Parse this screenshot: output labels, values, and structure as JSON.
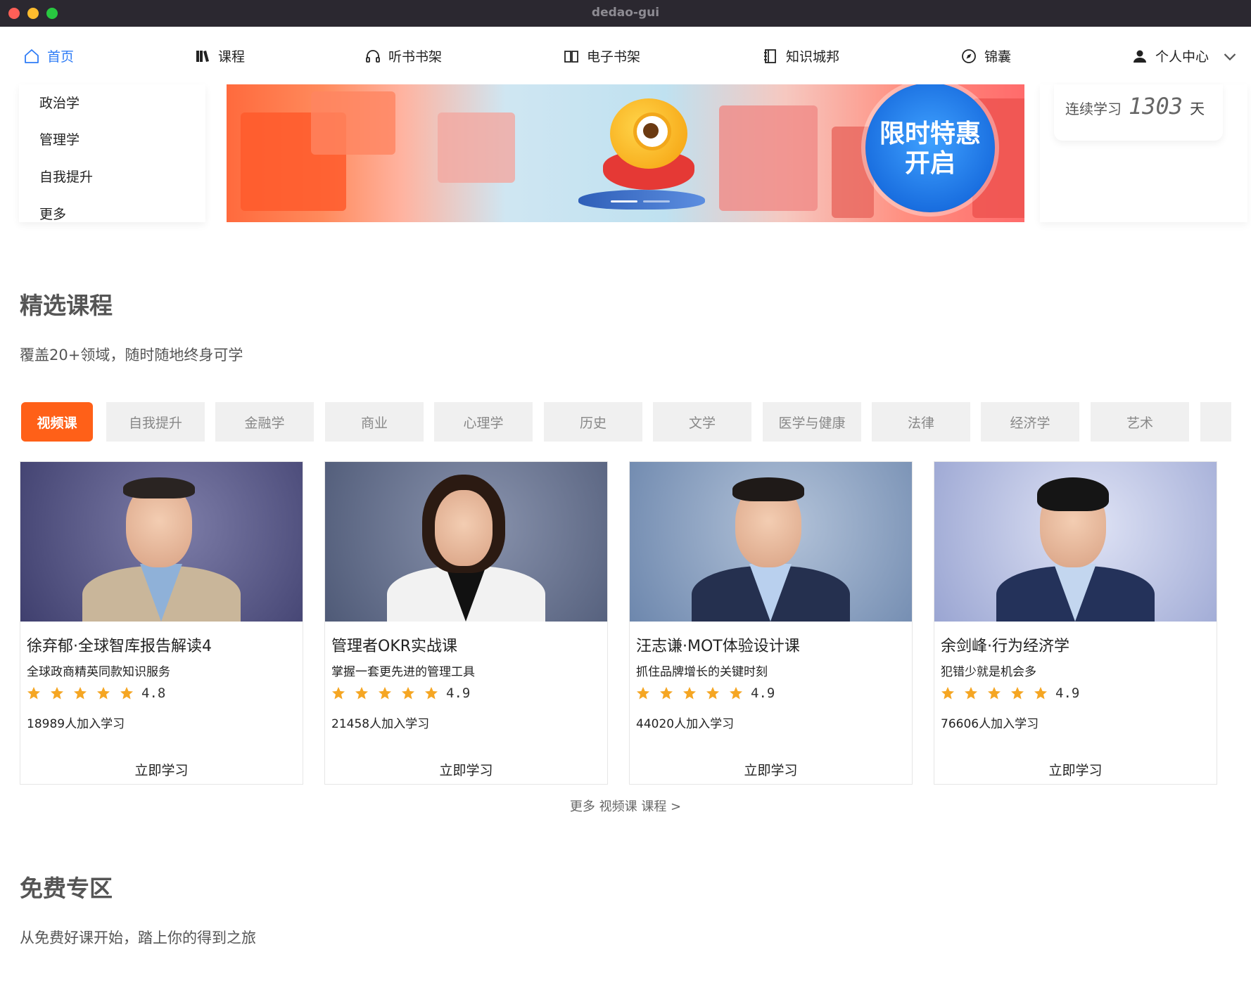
{
  "window": {
    "title": "dedao-gui"
  },
  "nav": {
    "items": [
      {
        "label": "首页"
      },
      {
        "label": "课程"
      },
      {
        "label": "听书书架"
      },
      {
        "label": "电子书架"
      },
      {
        "label": "知识城邦"
      },
      {
        "label": "锦囊"
      },
      {
        "label": "个人中心"
      }
    ],
    "active_color": "#2f7cf6"
  },
  "category_menu": {
    "items": [
      "政治学",
      "管理学",
      "自我提升",
      "更多"
    ]
  },
  "banner": {
    "text": "限时特惠开启",
    "badge_text_line1": "限时特惠",
    "badge_text_line2": "开启"
  },
  "streak": {
    "label": "连续学习",
    "days": "1303",
    "unit": "天"
  },
  "featured": {
    "title": "精选课程",
    "subtitle": "覆盖20+领域，随时随地终身可学",
    "tabs": [
      "视频课",
      "自我提升",
      "金融学",
      "商业",
      "心理学",
      "历史",
      "文学",
      "医学与健康",
      "法律",
      "经济学",
      "艺术"
    ],
    "active_tab_color": "#ff6018",
    "courses": [
      {
        "title": "徐弃郁·全球智库报告解读4",
        "subtitle": "全球政商精英同款知识服务",
        "rating": "4.8",
        "stars": 5,
        "learners": "18989人加入学习",
        "button": "立即学习"
      },
      {
        "title": "管理者OKR实战课",
        "subtitle": "掌握一套更先进的管理工具",
        "rating": "4.9",
        "stars": 5,
        "learners": "21458人加入学习",
        "button": "立即学习"
      },
      {
        "title": "汪志谦·MOT体验设计课",
        "subtitle": "抓住品牌增长的关键时刻",
        "rating": "4.9",
        "stars": 5,
        "learners": "44020人加入学习",
        "button": "立即学习"
      },
      {
        "title": "余剑峰·行为经济学",
        "subtitle": "犯错少就是机会多",
        "rating": "4.9",
        "stars": 5,
        "learners": "76606人加入学习",
        "button": "立即学习"
      }
    ],
    "more_link": "更多 视频课 课程 >",
    "star_color": "#f5a623"
  },
  "free_zone": {
    "title": "免费专区",
    "subtitle": "从免费好课开始，踏上你的得到之旅"
  }
}
